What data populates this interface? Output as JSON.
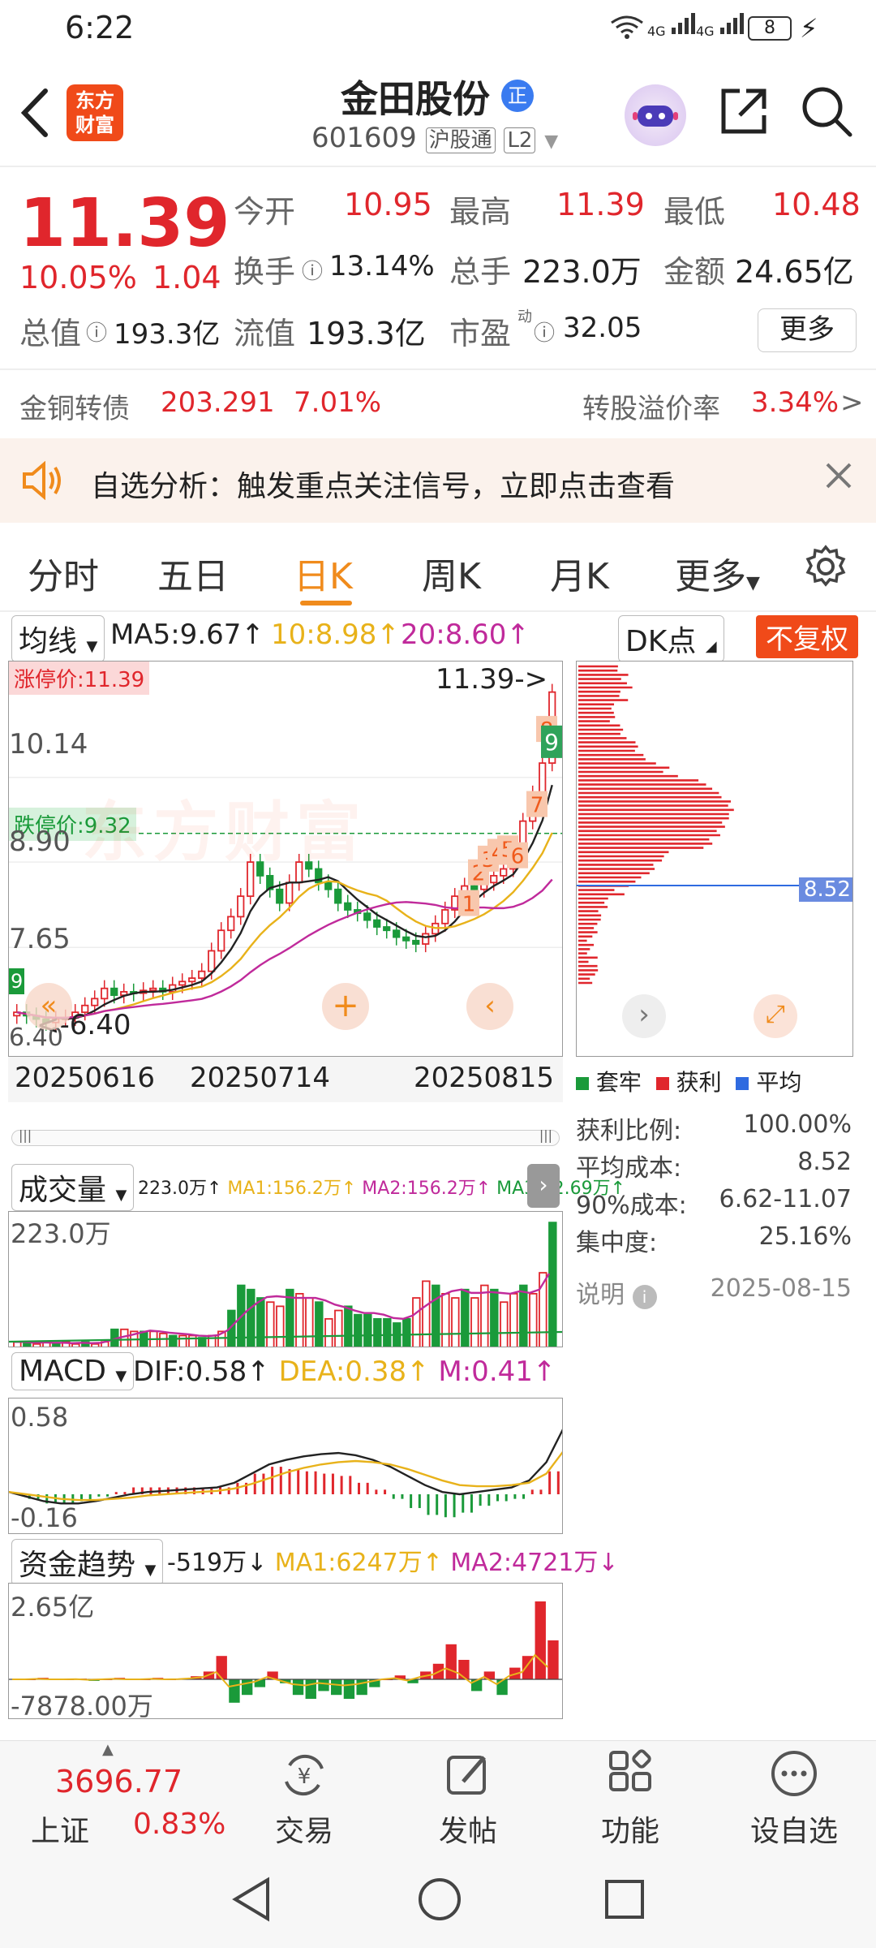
{
  "status": {
    "time": "6:22",
    "battery": "8",
    "net1": "4G",
    "net2": "4G"
  },
  "header": {
    "logo_line1": "东方",
    "logo_line2": "财富",
    "name": "金田股份",
    "badge": "正",
    "code": "601609",
    "tag1": "沪股通",
    "tag2": "L2"
  },
  "quote": {
    "price": "11.39",
    "pct": "10.05%",
    "chg": "1.04",
    "open_label": "今开",
    "open": "10.95",
    "high_label": "最高",
    "high": "11.39",
    "low_label": "最低",
    "low": "10.48",
    "turnover_label": "换手",
    "turnover": "13.14%",
    "volume_label": "总手",
    "volume": "223.0万",
    "amount_label": "金额",
    "amount": "24.65亿",
    "mktcap_label": "总值",
    "mktcap": "193.3亿",
    "float_label": "流值",
    "float": "193.3亿",
    "pe_label": "市盈",
    "pe_sup": "动",
    "pe": "32.05",
    "more_label": "更多",
    "bond_label": "金铜转债",
    "bond_price": "203.291",
    "bond_pct": "7.01%",
    "premium_label": "转股溢价率",
    "premium": "3.34%",
    "premium_arrow": ">"
  },
  "alert": {
    "text": "自选分析：触发重点关注信号，立即点击查看"
  },
  "tabs": [
    {
      "label": "分时"
    },
    {
      "label": "五日"
    },
    {
      "label": "日K"
    },
    {
      "label": "周K"
    },
    {
      "label": "月K"
    },
    {
      "label": "更多"
    }
  ],
  "active_tab": "日K",
  "kline": {
    "ma_selector": "均线",
    "ma5": "MA5:9.67↑",
    "ma10": "10:8.98↑",
    "ma20": "20:8.60↑",
    "limit_up_label": "涨停价:11.39",
    "limit_down_label": "跌停价:9.32",
    "last_price_tag": "11.39->",
    "low_price_tag": "<-6.40",
    "y_labels": [
      "10.14",
      "8.90",
      "7.65",
      "6.40"
    ],
    "x_labels": [
      "20250616",
      "20250714",
      "20250815"
    ],
    "signal_marks": [
      "1",
      "2",
      "3",
      "4",
      "5",
      "6",
      "7",
      "8",
      "9"
    ],
    "green_mark": "9",
    "left_edge_mark": "9",
    "watermark": "东方财富"
  },
  "chips": {
    "selector": "DK点",
    "restore_btn": "不复权",
    "avg_cost_tag": "8.52",
    "legend": [
      "套牢",
      "获利",
      "平均"
    ],
    "rows": [
      {
        "k": "获利比例:",
        "v": "100.00%"
      },
      {
        "k": "平均成本:",
        "v": "8.52"
      },
      {
        "k": "90%成本:",
        "v": "6.62-11.07"
      },
      {
        "k": "集中度:",
        "v": "25.16%"
      }
    ],
    "note_label": "说明",
    "date": "2025-08-15"
  },
  "volume": {
    "selector": "成交量",
    "v": "223.0万↑",
    "ma1": "MA1:156.2万↑",
    "ma2": "MA2:156.2万↑",
    "ma3": "MA3:52.69万↑",
    "ylabel": "223.0万"
  },
  "macd": {
    "selector": "MACD",
    "dif": "DIF:0.58↑",
    "dea": "DEA:0.38↑",
    "m": "M:0.41↑",
    "ytop": "0.58",
    "ybot": "-0.16"
  },
  "fund": {
    "selector": "资金趋势",
    "v": "-519万↓",
    "ma1": "MA1:6247万↑",
    "ma2": "MA2:4721万↓",
    "ytop": "2.65亿",
    "ybot": "-7878.00万"
  },
  "bottom": {
    "index_value": "3696.77",
    "index_name": "上证",
    "index_pct": "0.83%",
    "trade": "交易",
    "post": "发帖",
    "func": "功能",
    "watch": "设自选"
  },
  "colors": {
    "up": "#e0262c",
    "down": "#1a9a3a",
    "ma5": "#222222",
    "ma10": "#e8b21a",
    "ma20": "#c02a9b",
    "accent": "#f08b1c"
  }
}
